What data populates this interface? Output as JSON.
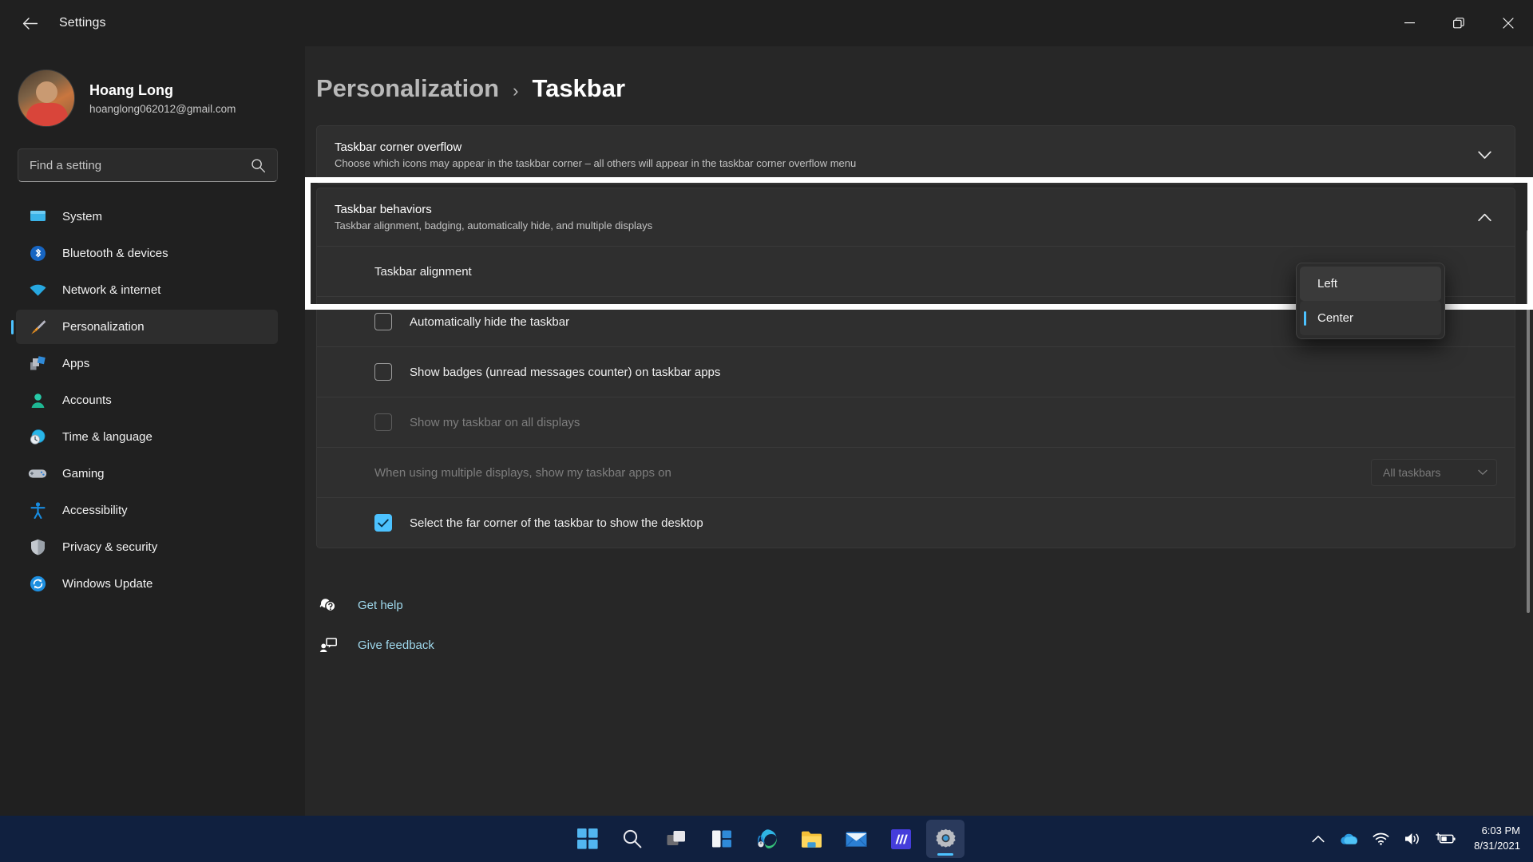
{
  "window": {
    "title": "Settings",
    "back_icon": "arrow-left-icon",
    "minimize_label": "Minimize",
    "maximize_label": "Restore",
    "close_label": "Close"
  },
  "profile": {
    "name": "Hoang Long",
    "email": "hoanglong062012@gmail.com"
  },
  "search": {
    "placeholder": "Find a setting",
    "value": "",
    "icon": "search-icon"
  },
  "sidebar": {
    "items": [
      {
        "label": "System",
        "icon": "monitor-icon",
        "active": false
      },
      {
        "label": "Bluetooth & devices",
        "icon": "bluetooth-icon",
        "active": false
      },
      {
        "label": "Network & internet",
        "icon": "wifi-icon",
        "active": false
      },
      {
        "label": "Personalization",
        "icon": "paintbrush-icon",
        "active": true
      },
      {
        "label": "Apps",
        "icon": "apps-icon",
        "active": false
      },
      {
        "label": "Accounts",
        "icon": "person-icon",
        "active": false
      },
      {
        "label": "Time & language",
        "icon": "clock-globe-icon",
        "active": false
      },
      {
        "label": "Gaming",
        "icon": "gamepad-icon",
        "active": false
      },
      {
        "label": "Accessibility",
        "icon": "accessibility-icon",
        "active": false
      },
      {
        "label": "Privacy & security",
        "icon": "shield-icon",
        "active": false
      },
      {
        "label": "Windows Update",
        "icon": "update-icon",
        "active": false
      }
    ]
  },
  "breadcrumb": {
    "parent": "Personalization",
    "separator": "›",
    "current": "Taskbar"
  },
  "cards": {
    "corner_overflow": {
      "title": "Taskbar corner overflow",
      "subtitle": "Choose which icons may appear in the taskbar corner – all others will appear in the taskbar corner overflow menu",
      "chevron": "chevron-down-icon"
    },
    "behaviors": {
      "title": "Taskbar behaviors",
      "subtitle": "Taskbar alignment, badging, automatically hide, and multiple displays",
      "chevron": "chevron-up-icon"
    }
  },
  "rows": {
    "alignment": {
      "label": "Taskbar alignment",
      "value": "Center"
    },
    "auto_hide": {
      "label": "Automatically hide the taskbar",
      "checked": false,
      "disabled": false
    },
    "badges": {
      "label": "Show badges (unread messages counter) on taskbar apps",
      "checked": false,
      "disabled": false
    },
    "all_displays": {
      "label": "Show my taskbar on all displays",
      "checked": false,
      "disabled": true
    },
    "multi_display": {
      "label": "When using multiple displays, show my taskbar apps on",
      "value": "All taskbars",
      "disabled": true
    },
    "far_corner": {
      "label": "Select the far corner of the taskbar to show the desktop",
      "checked": true,
      "disabled": false
    }
  },
  "dropdown": {
    "open": true,
    "options": [
      {
        "label": "Left",
        "state": "hover"
      },
      {
        "label": "Center",
        "state": "selected"
      }
    ]
  },
  "helpers": [
    {
      "label": "Get help",
      "icon": "help-icon"
    },
    {
      "label": "Give feedback",
      "icon": "feedback-icon"
    }
  ],
  "taskbar": {
    "apps": [
      {
        "name": "start-button",
        "icon": "windows-logo-icon",
        "active": false
      },
      {
        "name": "search-button",
        "icon": "search-icon",
        "active": false
      },
      {
        "name": "task-view-button",
        "icon": "task-view-icon",
        "active": false
      },
      {
        "name": "widgets-button",
        "icon": "widgets-icon",
        "active": false
      },
      {
        "name": "edge-button",
        "icon": "edge-icon",
        "active": false
      },
      {
        "name": "file-explorer-button",
        "icon": "folder-icon",
        "active": false
      },
      {
        "name": "mail-button",
        "icon": "mail-icon",
        "active": false
      },
      {
        "name": "app-button",
        "icon": "app-icon",
        "active": false
      },
      {
        "name": "settings-button",
        "icon": "gear-icon",
        "active": true
      }
    ],
    "tray": {
      "overflow_icon": "chevron-up-icon",
      "cloud_icon": "onedrive-icon",
      "wifi_icon": "wifi-icon",
      "volume_icon": "speaker-icon",
      "battery_icon": "battery-charging-icon",
      "time": "6:03 PM",
      "date": "8/31/2021"
    }
  },
  "colors": {
    "accent": "#4cc2ff",
    "link": "#9fd8ec",
    "highlight_box": "#ffffff"
  }
}
